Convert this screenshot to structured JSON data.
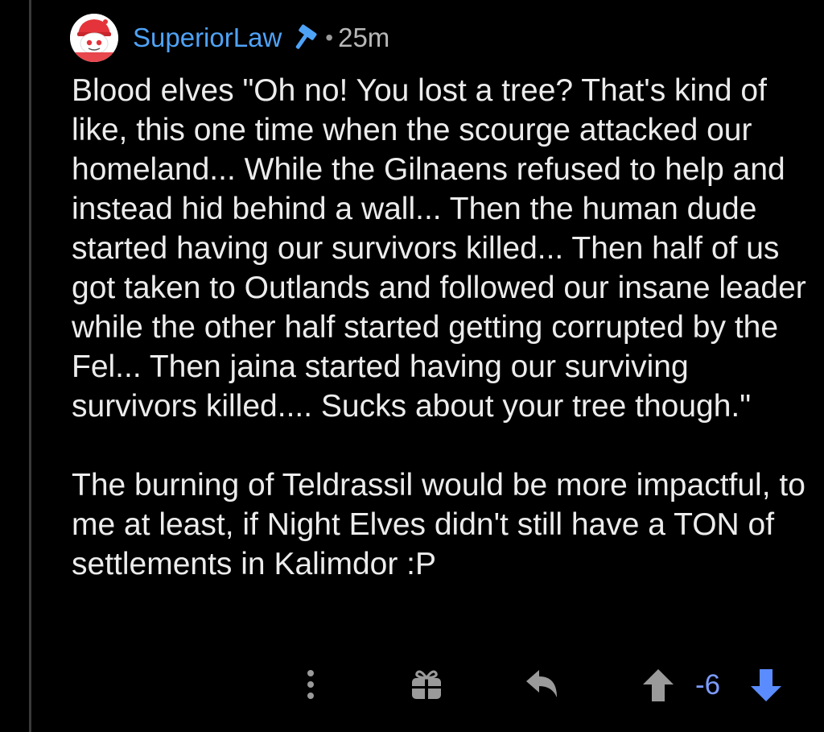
{
  "comment": {
    "username": "SuperiorLaw",
    "separator": "•",
    "timestamp": "25m",
    "avatar_icon": "reddit-snoo-avatar-icon",
    "flair_icon": "hammer-icon",
    "paragraphs": [
      "Blood elves \"Oh no! You lost a tree? That's kind of like, this one time when the scourge attacked our homeland... While the Gilnaens refused to help and instead hid behind a wall... Then the human dude started having our survivors killed... Then half of us got taken to Outlands and followed our insane leader while the other half started getting corrupted by the Fel... Then jaina started having our surviving survivors killed.... Sucks about your tree though.\"",
      "The burning of Teldrassil would be more impactful, to me at least, if Night Elves didn't still have a TON of settlements in Kalimdor :P"
    ]
  },
  "actions": {
    "more_icon": "more-vertical-icon",
    "award_icon": "gift-award-icon",
    "reply_icon": "reply-arrow-icon",
    "upvote_icon": "upvote-arrow-icon",
    "score": "-6",
    "downvote_icon": "downvote-arrow-icon"
  },
  "colors": {
    "background": "#000000",
    "username": "#4fa3f7",
    "text": "#ececec",
    "meta": "#b8b8b8",
    "icon_gray": "#9a9a9a",
    "downvote_blue": "#5b8cff",
    "score_blue": "#7c9cff"
  }
}
